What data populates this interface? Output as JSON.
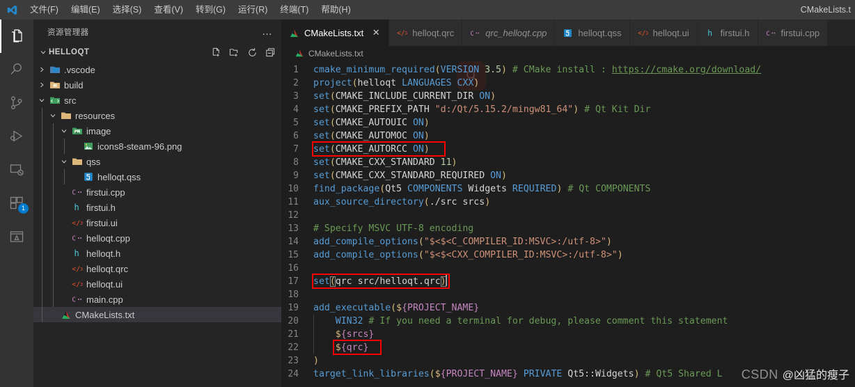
{
  "window": {
    "title": "CMakeLists.t",
    "logo_icon": "vscode-logo-icon"
  },
  "menu": {
    "items": [
      {
        "label": "文件(F)",
        "name": "menu-file"
      },
      {
        "label": "编辑(E)",
        "name": "menu-edit"
      },
      {
        "label": "选择(S)",
        "name": "menu-selection"
      },
      {
        "label": "查看(V)",
        "name": "menu-view"
      },
      {
        "label": "转到(G)",
        "name": "menu-go"
      },
      {
        "label": "运行(R)",
        "name": "menu-run"
      },
      {
        "label": "终端(T)",
        "name": "menu-terminal"
      },
      {
        "label": "帮助(H)",
        "name": "menu-help"
      }
    ]
  },
  "activitybar": {
    "items": [
      {
        "icon": "explorer-files-icon",
        "active": true,
        "badge": ""
      },
      {
        "icon": "search-icon",
        "active": false,
        "badge": ""
      },
      {
        "icon": "source-control-icon",
        "active": false,
        "badge": ""
      },
      {
        "icon": "run-and-debug-icon",
        "active": false,
        "badge": ""
      },
      {
        "icon": "remote-explorer-icon",
        "active": false,
        "badge": ""
      },
      {
        "icon": "extensions-icon",
        "active": false,
        "badge": "1"
      },
      {
        "icon": "cmake-tools-icon",
        "active": false,
        "badge": ""
      }
    ]
  },
  "sidebar": {
    "title": "资源管理器",
    "more_actions": "…",
    "root": {
      "label": "HELLOQT",
      "expanded": true,
      "actions": [
        {
          "icon": "new-file-icon"
        },
        {
          "icon": "new-folder-icon"
        },
        {
          "icon": "refresh-icon"
        },
        {
          "icon": "collapse-all-icon"
        }
      ]
    },
    "tree": [
      {
        "label": ".vscode",
        "depth": 1,
        "type": "folder",
        "icon": "folder-vscode-icon",
        "expanded": false,
        "chevron": "right",
        "selected": false
      },
      {
        "label": "build",
        "depth": 1,
        "type": "folder",
        "icon": "folder-build-icon",
        "expanded": false,
        "chevron": "right",
        "selected": false
      },
      {
        "label": "src",
        "depth": 1,
        "type": "folder",
        "icon": "folder-src-icon",
        "expanded": true,
        "chevron": "down",
        "selected": false
      },
      {
        "label": "resources",
        "depth": 2,
        "type": "folder",
        "icon": "folder-resources-icon",
        "expanded": true,
        "chevron": "down",
        "selected": false
      },
      {
        "label": "image",
        "depth": 3,
        "type": "folder",
        "icon": "folder-image-icon",
        "expanded": true,
        "chevron": "down",
        "selected": false
      },
      {
        "label": "icons8-steam-96.png",
        "depth": 4,
        "type": "file",
        "icon": "image-file-icon",
        "selected": false
      },
      {
        "label": "qss",
        "depth": 3,
        "type": "folder",
        "icon": "folder-qss-icon",
        "expanded": true,
        "chevron": "down",
        "selected": false
      },
      {
        "label": "helloqt.qss",
        "depth": 4,
        "type": "file",
        "icon": "css-file-icon",
        "selected": false
      },
      {
        "label": "firstui.cpp",
        "depth": 3,
        "type": "file",
        "icon": "cpp-file-icon",
        "selected": false
      },
      {
        "label": "firstui.h",
        "depth": 3,
        "type": "file",
        "icon": "header-file-icon",
        "selected": false
      },
      {
        "label": "firstui.ui",
        "depth": 3,
        "type": "file",
        "icon": "xml-file-icon",
        "selected": false
      },
      {
        "label": "helloqt.cpp",
        "depth": 3,
        "type": "file",
        "icon": "cpp-file-icon",
        "selected": false
      },
      {
        "label": "helloqt.h",
        "depth": 3,
        "type": "file",
        "icon": "header-file-icon",
        "selected": false
      },
      {
        "label": "helloqt.qrc",
        "depth": 3,
        "type": "file",
        "icon": "xml-file-icon",
        "selected": false
      },
      {
        "label": "helloqt.ui",
        "depth": 3,
        "type": "file",
        "icon": "xml-file-icon",
        "selected": false
      },
      {
        "label": "main.cpp",
        "depth": 3,
        "type": "file",
        "icon": "cpp-file-icon",
        "selected": false
      },
      {
        "label": "CMakeLists.txt",
        "depth": 2,
        "type": "file",
        "icon": "cmake-file-icon",
        "selected": true
      }
    ]
  },
  "tabs": [
    {
      "label": "CMakeLists.txt",
      "icon": "cmake-file-icon",
      "active": true,
      "preview": false,
      "close": "✕"
    },
    {
      "label": "helloqt.qrc",
      "icon": "xml-file-icon",
      "active": false,
      "preview": false,
      "close": ""
    },
    {
      "label": "qrc_helloqt.cpp",
      "icon": "cpp-file-icon",
      "active": false,
      "preview": true,
      "close": ""
    },
    {
      "label": "helloqt.qss",
      "icon": "css-file-icon",
      "active": false,
      "preview": false,
      "close": ""
    },
    {
      "label": "helloqt.ui",
      "icon": "xml-file-icon",
      "active": false,
      "preview": false,
      "close": ""
    },
    {
      "label": "firstui.h",
      "icon": "header-file-icon",
      "active": false,
      "preview": false,
      "close": ""
    },
    {
      "label": "firstui.cpp",
      "icon": "cpp-file-icon",
      "active": false,
      "preview": false,
      "close": ""
    }
  ],
  "breadcrumb": {
    "icon": "cmake-file-icon",
    "label": "CMakeLists.txt"
  },
  "editor": {
    "filename": "CMakeLists.txt",
    "line_count": 24,
    "cursor_line": 17,
    "lines": [
      {
        "n": "1",
        "text": "cmake_minimum_required(VERSION 3.5) # CMake install : https://cmake.org/download/"
      },
      {
        "n": "2",
        "text": "project(helloqt LANGUAGES CXX)"
      },
      {
        "n": "3",
        "text": "set(CMAKE_INCLUDE_CURRENT_DIR ON)"
      },
      {
        "n": "4",
        "text": "set(CMAKE_PREFIX_PATH \"d:/Qt/5.15.2/mingw81_64\") # Qt Kit Dir"
      },
      {
        "n": "5",
        "text": "set(CMAKE_AUTOUIC ON)"
      },
      {
        "n": "6",
        "text": "set(CMAKE_AUTOMOC ON)"
      },
      {
        "n": "7",
        "text": "set(CMAKE_AUTORCC ON)"
      },
      {
        "n": "8",
        "text": "set(CMAKE_CXX_STANDARD 11)"
      },
      {
        "n": "9",
        "text": "set(CMAKE_CXX_STANDARD_REQUIRED ON)"
      },
      {
        "n": "10",
        "text": "find_package(Qt5 COMPONENTS Widgets REQUIRED) # Qt COMPONENTS"
      },
      {
        "n": "11",
        "text": "aux_source_directory(./src srcs)"
      },
      {
        "n": "12",
        "text": ""
      },
      {
        "n": "13",
        "text": "# Specify MSVC UTF-8 encoding"
      },
      {
        "n": "14",
        "text": "add_compile_options(\"$<$<C_COMPILER_ID:MSVC>:/utf-8>\")"
      },
      {
        "n": "15",
        "text": "add_compile_options(\"$<$<CXX_COMPILER_ID:MSVC>:/utf-8>\")"
      },
      {
        "n": "16",
        "text": ""
      },
      {
        "n": "17",
        "text": "set(qrc src/helloqt.qrc)"
      },
      {
        "n": "18",
        "text": ""
      },
      {
        "n": "19",
        "text": "add_executable(${PROJECT_NAME}"
      },
      {
        "n": "20",
        "text": "    WIN32 # If you need a terminal for debug, please comment this statement"
      },
      {
        "n": "21",
        "text": "    ${srcs}"
      },
      {
        "n": "22",
        "text": "    ${qrc}"
      },
      {
        "n": "23",
        "text": ")"
      },
      {
        "n": "24",
        "text": "target_link_libraries(${PROJECT_NAME} PRIVATE Qt5::Widgets) # Qt5 Shared L"
      }
    ],
    "annotations": [
      {
        "name": "highlight-box-autorcc",
        "line": 7,
        "color": "#ff0000"
      },
      {
        "name": "highlight-box-set-qrc",
        "line": 17,
        "color": "#ff0000"
      },
      {
        "name": "highlight-box-qrc-var",
        "line": 22,
        "color": "#ff0000"
      }
    ]
  },
  "watermark": {
    "mark": "CSDN",
    "user": "@凶猛的瘦子",
    "search_glyph": "search-icon"
  },
  "colors": {
    "accent": "#007acc",
    "annotation": "#ff0000",
    "editor_bg": "#1e1e1e",
    "sidebar_bg": "#252526",
    "activitybar_bg": "#333333",
    "titlebar_bg": "#3c3c3c",
    "selection_bg": "#37373d"
  }
}
